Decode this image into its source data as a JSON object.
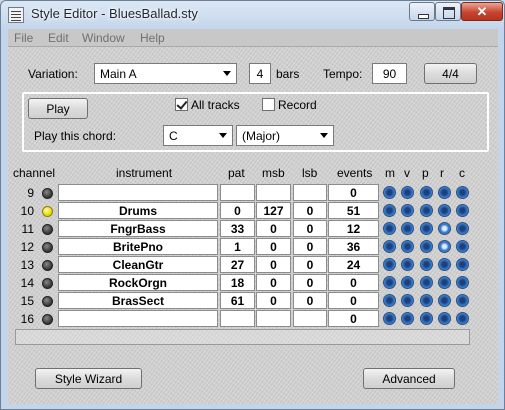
{
  "window": {
    "title": "Style Editor - BluesBallad.sty"
  },
  "menu": [
    "File",
    "Edit",
    "Window",
    "Help"
  ],
  "settings": {
    "variation_label": "Variation:",
    "variation_value": "Main A",
    "bars_value": "4",
    "bars_label": "bars",
    "tempo_label": "Tempo:",
    "tempo_value": "90",
    "time_sig_button": "4/4"
  },
  "playback": {
    "play_button": "Play",
    "all_tracks_label": "All tracks",
    "all_tracks_checked": true,
    "record_label": "Record",
    "record_checked": false,
    "chord_label": "Play this chord:",
    "chord_root": "C",
    "chord_type": "(Major)"
  },
  "table": {
    "headers": [
      "channel",
      "instrument",
      "pat",
      "msb",
      "lsb",
      "events",
      "m",
      "v",
      "p",
      "r",
      "c"
    ],
    "rows": [
      {
        "channel": "9",
        "instrument": "",
        "pat": "",
        "msb": "",
        "lsb": "",
        "events": "0",
        "active": false,
        "v_on": false,
        "r_on": false
      },
      {
        "channel": "10",
        "instrument": "Drums",
        "pat": "0",
        "msb": "127",
        "lsb": "0",
        "events": "51",
        "active": true,
        "v_on": false,
        "r_on": false
      },
      {
        "channel": "11",
        "instrument": "FngrBass",
        "pat": "33",
        "msb": "0",
        "lsb": "0",
        "events": "12",
        "active": false,
        "v_on": false,
        "r_on": true
      },
      {
        "channel": "12",
        "instrument": "BritePno",
        "pat": "1",
        "msb": "0",
        "lsb": "0",
        "events": "36",
        "active": false,
        "v_on": false,
        "r_on": true
      },
      {
        "channel": "13",
        "instrument": "CleanGtr",
        "pat": "27",
        "msb": "0",
        "lsb": "0",
        "events": "24",
        "active": false,
        "v_on": false,
        "r_on": false
      },
      {
        "channel": "14",
        "instrument": "RockOrgn",
        "pat": "18",
        "msb": "0",
        "lsb": "0",
        "events": "0",
        "active": false,
        "v_on": false,
        "r_on": false
      },
      {
        "channel": "15",
        "instrument": "BrasSect",
        "pat": "61",
        "msb": "0",
        "lsb": "0",
        "events": "0",
        "active": false,
        "v_on": false,
        "r_on": false
      },
      {
        "channel": "16",
        "instrument": "",
        "pat": "",
        "msb": "",
        "lsb": "",
        "events": "0",
        "active": false,
        "v_on": false,
        "r_on": false
      }
    ]
  },
  "footer": {
    "style_wizard_button": "Style Wizard",
    "advanced_button": "Advanced"
  }
}
